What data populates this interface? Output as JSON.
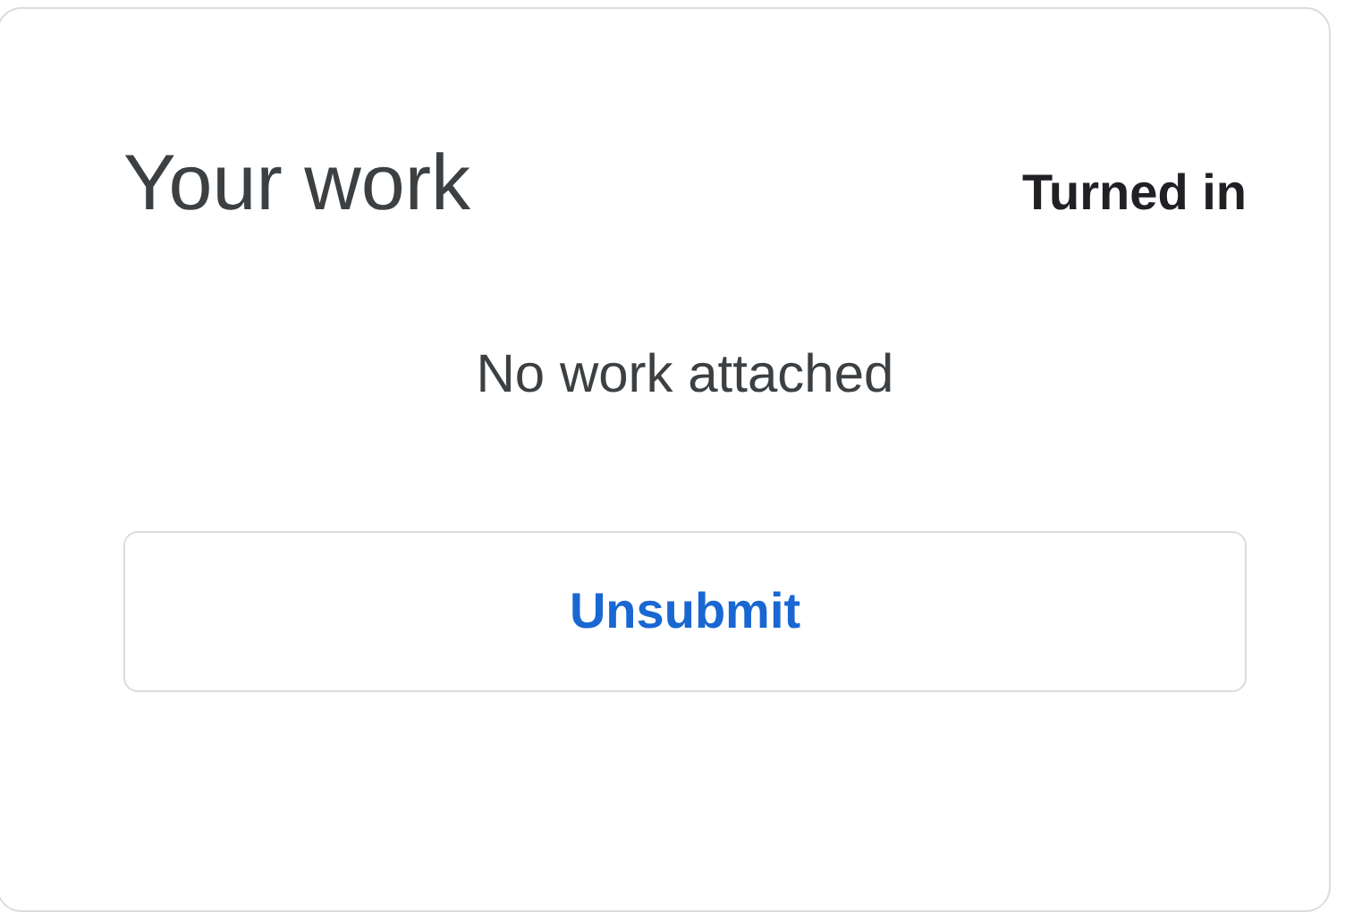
{
  "card": {
    "title": "Your work",
    "status": "Turned in",
    "message": "No work attached",
    "button": "Unsubmit"
  }
}
